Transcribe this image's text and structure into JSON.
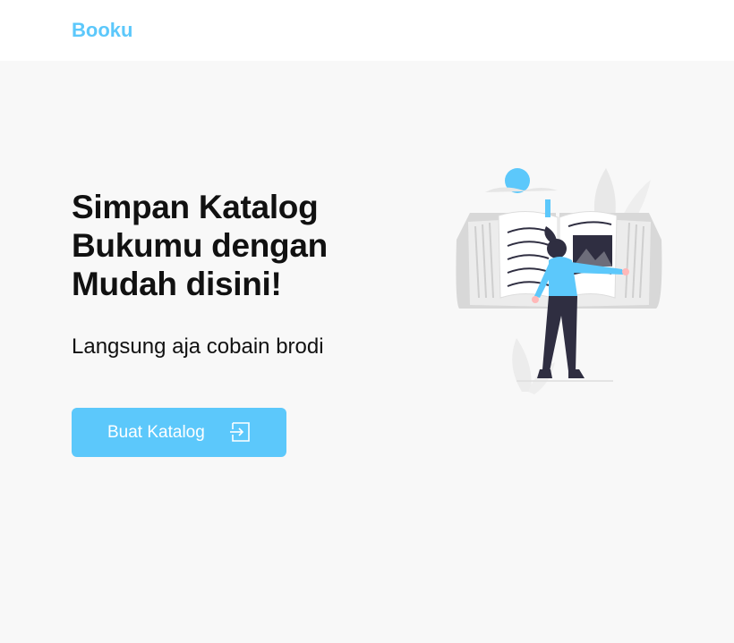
{
  "navbar": {
    "brand": "Booku"
  },
  "hero": {
    "headline": "Simpan Katalog Bukumu dengan Mudah disini!",
    "subtitle": "Langsung aja cobain brodi",
    "cta_label": "Buat Katalog",
    "cta_icon": "sign-in-arrow-icon",
    "illustration": "woman-reading-open-book-illustration"
  },
  "colors": {
    "accent": "#5cc8fb",
    "background": "#f8f8f8",
    "navbar": "#ffffff",
    "text": "#111111"
  }
}
